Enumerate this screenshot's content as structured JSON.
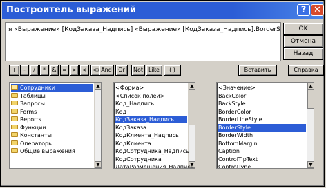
{
  "window": {
    "title": "Построитель выражений",
    "help_icon": "?",
    "close_icon": "✕"
  },
  "expression": {
    "text": "я «Выражение» [КодЗаказа_Надпись] «Выражение» [КодЗаказа_Надпись].BorderStyle"
  },
  "buttons": {
    "ok": "OK",
    "cancel": "Отмена",
    "back": "Назад",
    "paste": "Вставить",
    "help": "Справка"
  },
  "operators": [
    "+",
    "-",
    "/",
    "*",
    "&",
    "=",
    ">",
    "<",
    "<>",
    "And",
    "Or",
    "Not",
    "Like",
    "( )"
  ],
  "list1": {
    "items": [
      "Сотрудники",
      "Таблицы",
      "Запросы",
      "Forms",
      "Reports",
      "Функции",
      "Константы",
      "Операторы",
      "Общие выражения"
    ],
    "selected_index": 0
  },
  "list2": {
    "items": [
      "<Форма>",
      "<Список полей>",
      "Код_Надпись",
      "Код",
      "КодЗаказа_Надпись",
      "КодЗаказа",
      "КодКлиента_Надпись",
      "КодКлиента",
      "КодСотрудника_Надпись",
      "КодСотрудника",
      "ДатаРазмещения_Надпись"
    ],
    "selected_index": 4
  },
  "list3": {
    "items": [
      "<Значение>",
      "BackColor",
      "BackStyle",
      "BorderColor",
      "BorderLineStyle",
      "BorderStyle",
      "BorderWidth",
      "BottomMargin",
      "Caption",
      "ControlTipText",
      "ControlType"
    ],
    "selected_index": 5
  }
}
